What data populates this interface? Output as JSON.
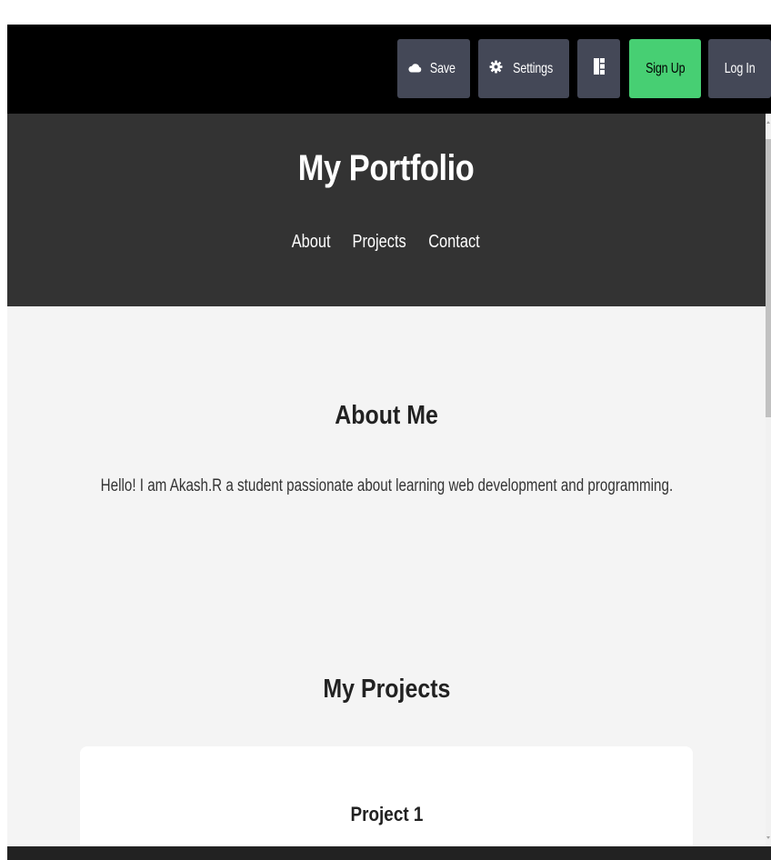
{
  "toolbar": {
    "save_label": "Save",
    "settings_label": "Settings",
    "signup_label": "Sign Up",
    "login_label": "Log In",
    "icons": {
      "save": "cloud-icon",
      "settings": "gear-icon",
      "layout": "layout-icon"
    }
  },
  "preview": {
    "header": {
      "title": "My Portfolio",
      "nav": [
        "About",
        "Projects",
        "Contact"
      ]
    },
    "about": {
      "heading": "About Me",
      "text": "Hello! I am Akash.R a student passionate about learning web development and programming."
    },
    "projects": {
      "heading": "My Projects",
      "items": [
        {
          "title": "Project 1"
        }
      ]
    }
  },
  "colors": {
    "toolbar_bg": "#000000",
    "button_bg": "#444857",
    "signup_bg": "#47cf73",
    "header_bg": "#333333",
    "page_bg": "#f4f4f4",
    "card_bg": "#ffffff"
  }
}
